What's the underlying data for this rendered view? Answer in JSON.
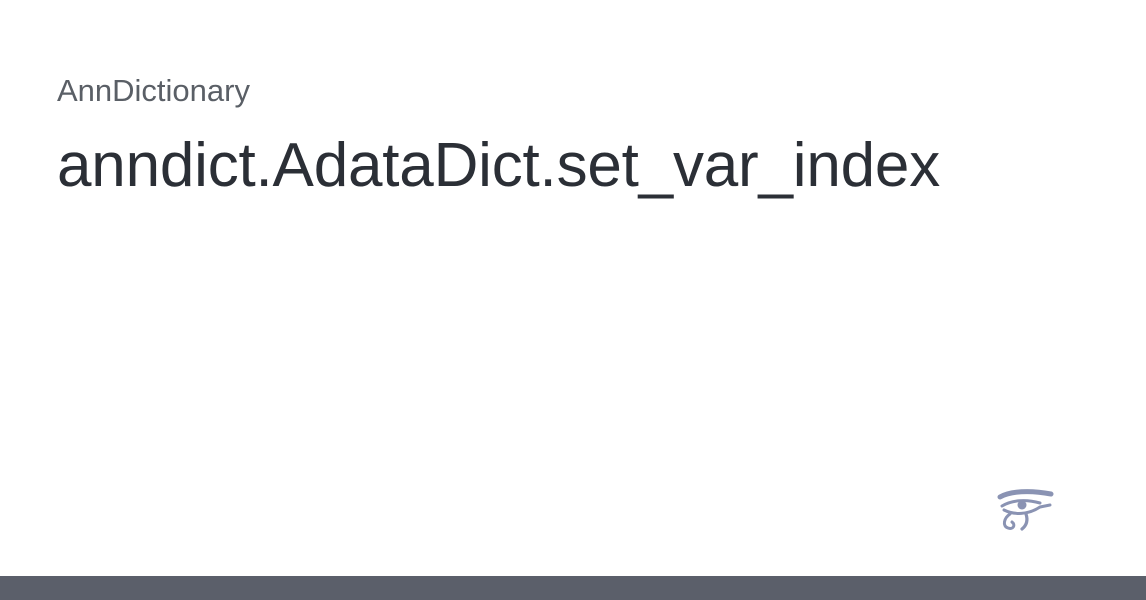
{
  "site": {
    "name": "AnnDictionary"
  },
  "page": {
    "title": "anndict.AdataDict.set_var_index"
  },
  "logo": {
    "icon": "eye-of-horus-icon",
    "color": "#8a93b3"
  },
  "colors": {
    "background": "#ffffff",
    "site_name": "#5a5f66",
    "title": "#2b2f36",
    "bottom_bar": "#5b5f6a"
  }
}
